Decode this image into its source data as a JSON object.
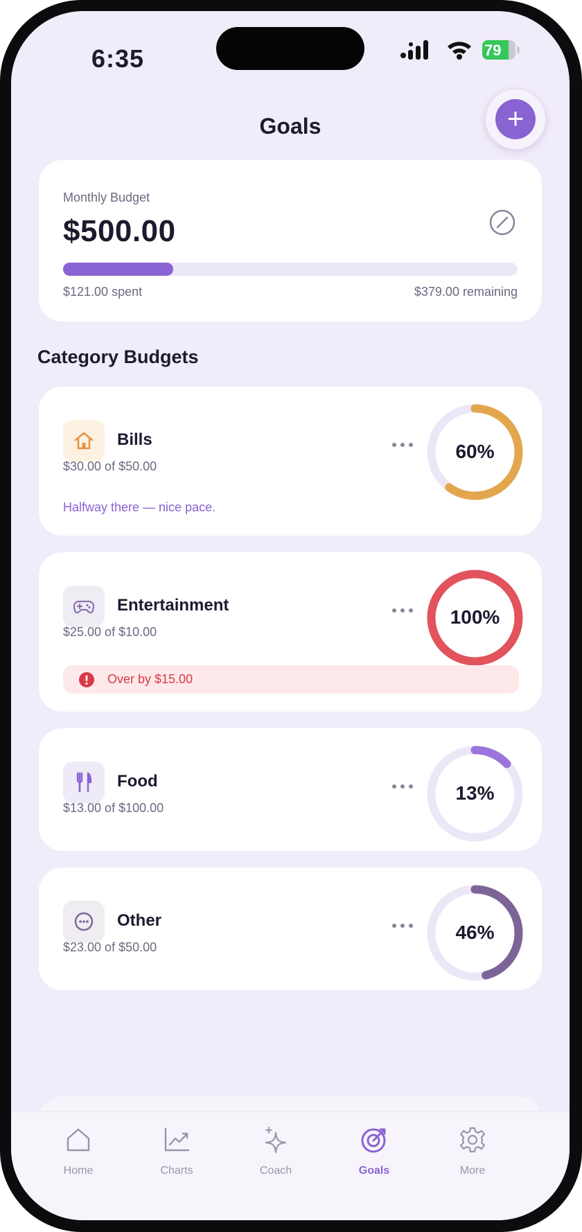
{
  "status_bar": {
    "time": "6:35",
    "battery": "79",
    "battery_level": 0.79
  },
  "header": {
    "title": "Goals",
    "add_icon": "plus-icon"
  },
  "monthly_budget": {
    "label": "Monthly Budget",
    "amount": "$500.00",
    "spent": "$121.00 spent",
    "remaining": "$379.00 remaining",
    "progress": 0.242,
    "edit_icon": "pencil-icon"
  },
  "section_title": "Category Budgets",
  "categories": [
    {
      "name": "Bills",
      "amount": "$30.00 of $50.00",
      "percent": "60%",
      "progress": 0.6,
      "color": "#e3a64e",
      "icon": "house-icon",
      "note": "Halfway there — nice pace."
    },
    {
      "name": "Entertainment",
      "amount": "$25.00 of $10.00",
      "percent": "100%",
      "progress": 1.0,
      "color": "#e2535c",
      "icon": "gamepad-icon",
      "alert": "Over by $15.00"
    },
    {
      "name": "Food",
      "amount": "$13.00 of $100.00",
      "percent": "13%",
      "progress": 0.13,
      "color": "#9b74dd",
      "icon": "utensils-icon"
    },
    {
      "name": "Other",
      "amount": "$23.00 of $50.00",
      "percent": "46%",
      "progress": 0.46,
      "color": "#7d6496",
      "icon": "ellipsis-circle-icon"
    }
  ],
  "tabs": [
    {
      "label": "Home",
      "icon": "home-icon"
    },
    {
      "label": "Charts",
      "icon": "chart-icon"
    },
    {
      "label": "Coach",
      "icon": "sparkle-icon"
    },
    {
      "label": "Goals",
      "icon": "target-icon",
      "active": true
    },
    {
      "label": "More",
      "icon": "gear-icon"
    }
  ],
  "colors": {
    "accent": "#8a63d2",
    "background": "#f1ecf9",
    "danger": "#d83a46",
    "track": "#ece7f7"
  }
}
